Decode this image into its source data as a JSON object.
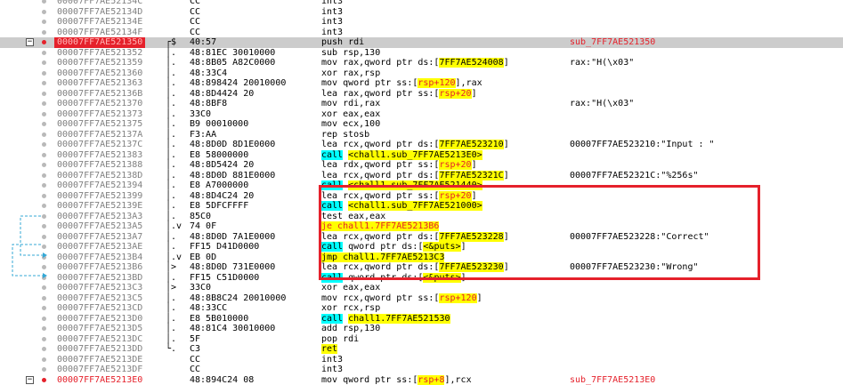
{
  "colors": {
    "breakpoint": "#e5212b",
    "selection": "#cccccc",
    "highlight_yellow": "#ffff00",
    "highlight_cyan": "#00ffff",
    "annotation_box": "#e5212b"
  },
  "icons": {
    "breakpoint": "breakpoint-dot-icon",
    "fold": "collapse-box-icon",
    "jump_arrow": "jump-arrow-icon"
  },
  "fold_symbol": "−",
  "rows": [
    {
      "addr": "00007FF7AE52134C",
      "bytes": "CC",
      "instr": [
        [
          "int3",
          ""
        ]
      ],
      "comment": ""
    },
    {
      "addr": "00007FF7AE52134D",
      "bytes": "CC",
      "instr": [
        [
          "int3",
          ""
        ]
      ],
      "comment": ""
    },
    {
      "addr": "00007FF7AE52134E",
      "bytes": "CC",
      "instr": [
        [
          "int3",
          ""
        ]
      ],
      "comment": ""
    },
    {
      "addr": "00007FF7AE52134F",
      "bytes": "CC",
      "instr": [
        [
          "int3",
          ""
        ]
      ],
      "comment": ""
    },
    {
      "addr": "00007FF7AE521350",
      "flag": "┌$",
      "bytes": "40:57",
      "instr": [
        [
          "push rdi",
          ""
        ]
      ],
      "comment": "sub_7FF7AE521350",
      "current": true,
      "bp": "on",
      "fold": true,
      "commentRed": true
    },
    {
      "addr": "00007FF7AE521352",
      "flag": "│.",
      "bytes": "48:81EC 30010000",
      "instr": [
        [
          "sub rsp,130",
          ""
        ]
      ],
      "comment": ""
    },
    {
      "addr": "00007FF7AE521359",
      "flag": "│.",
      "bytes": "48:8B05 A82C0000",
      "instr": [
        [
          "mov rax,qword ptr ds:[",
          ""
        ],
        [
          "7FF7AE524008",
          "y"
        ],
        [
          "]",
          ""
        ]
      ],
      "comment": "rax:\"H⁣⁣(⁣\\x03\""
    },
    {
      "addr": "00007FF7AE521360",
      "flag": "│.",
      "bytes": "48:33C4",
      "instr": [
        [
          "xor rax,rsp",
          ""
        ]
      ],
      "comment": ""
    },
    {
      "addr": "00007FF7AE521363",
      "flag": "│.",
      "bytes": "48:898424 20010000",
      "instr": [
        [
          "mov qword ptr ss:[",
          ""
        ],
        [
          "rsp+120",
          "yr"
        ],
        [
          "],rax",
          ""
        ]
      ],
      "comment": ""
    },
    {
      "addr": "00007FF7AE52136B",
      "flag": "│.",
      "bytes": "48:8D4424 20",
      "instr": [
        [
          "lea rax,qword ptr ss:[",
          ""
        ],
        [
          "rsp+20",
          "yr"
        ],
        [
          "]",
          ""
        ]
      ],
      "comment": ""
    },
    {
      "addr": "00007FF7AE521370",
      "flag": "│.",
      "bytes": "48:8BF8",
      "instr": [
        [
          "mov rdi,rax",
          ""
        ]
      ],
      "comment": "rax:\"H⁣⁣(⁣\\x03\""
    },
    {
      "addr": "00007FF7AE521373",
      "flag": "│.",
      "bytes": "33C0",
      "instr": [
        [
          "xor eax,eax",
          ""
        ]
      ],
      "comment": ""
    },
    {
      "addr": "00007FF7AE521375",
      "flag": "│.",
      "bytes": "B9 00010000",
      "instr": [
        [
          "mov ecx,100",
          ""
        ]
      ],
      "comment": ""
    },
    {
      "addr": "00007FF7AE52137A",
      "flag": "│.",
      "bytes": "F3:AA",
      "instr": [
        [
          "rep stosb",
          ""
        ]
      ],
      "comment": ""
    },
    {
      "addr": "00007FF7AE52137C",
      "flag": "│.",
      "bytes": "48:8D0D 8D1E0000",
      "instr": [
        [
          "lea rcx,qword ptr ds:[",
          ""
        ],
        [
          "7FF7AE523210",
          "y"
        ],
        [
          "]",
          ""
        ]
      ],
      "comment": "00007FF7AE523210:\"Input : \""
    },
    {
      "addr": "00007FF7AE521383",
      "flag": "│.",
      "bytes": "E8 58000000",
      "instr": [
        [
          "call",
          "c"
        ],
        [
          " ",
          ""
        ],
        [
          "<chall1.sub_7FF7AE5213E0>",
          "y"
        ]
      ],
      "comment": ""
    },
    {
      "addr": "00007FF7AE521388",
      "flag": "│.",
      "bytes": "48:8D5424 20",
      "instr": [
        [
          "lea rdx,qword ptr ss:[",
          ""
        ],
        [
          "rsp+20",
          "yr"
        ],
        [
          "]",
          ""
        ]
      ],
      "comment": ""
    },
    {
      "addr": "00007FF7AE52138D",
      "flag": "│.",
      "bytes": "48:8D0D 881E0000",
      "instr": [
        [
          "lea rcx,qword ptr ds:[",
          ""
        ],
        [
          "7FF7AE52321C",
          "y"
        ],
        [
          "]",
          ""
        ]
      ],
      "comment": "00007FF7AE52321C:\"%256s\""
    },
    {
      "addr": "00007FF7AE521394",
      "flag": "│.",
      "bytes": "E8 A7000000",
      "instr": [
        [
          "call",
          "c"
        ],
        [
          " ",
          ""
        ],
        [
          "<chall1.sub_7FF7AE521440>",
          "y"
        ]
      ],
      "comment": ""
    },
    {
      "addr": "00007FF7AE521399",
      "flag": "│.",
      "bytes": "48:8D4C24 20",
      "instr": [
        [
          "lea rcx,qword ptr ss:[",
          ""
        ],
        [
          "rsp+20",
          "yr"
        ],
        [
          "]",
          ""
        ]
      ],
      "comment": ""
    },
    {
      "addr": "00007FF7AE52139E",
      "flag": "│.",
      "bytes": "E8 5DFCFFFF",
      "instr": [
        [
          "call",
          "c"
        ],
        [
          " ",
          ""
        ],
        [
          "<chall1.sub_7FF7AE521000>",
          "y"
        ]
      ],
      "comment": ""
    },
    {
      "addr": "00007FF7AE5213A3",
      "flag": "│.",
      "bytes": "85C0",
      "instr": [
        [
          "test eax,eax",
          ""
        ]
      ],
      "comment": ""
    },
    {
      "addr": "00007FF7AE5213A5",
      "flag": "│.v",
      "bytes": "74 0F",
      "instr": [
        [
          "je chall1.7FF7AE5213B6",
          "yr"
        ]
      ],
      "comment": ""
    },
    {
      "addr": "00007FF7AE5213A7",
      "flag": "│.",
      "bytes": "48:8D0D 7A1E0000",
      "instr": [
        [
          "lea rcx,qword ptr ds:[",
          ""
        ],
        [
          "7FF7AE523228",
          "y"
        ],
        [
          "]",
          ""
        ]
      ],
      "comment": "00007FF7AE523228:\"Correct\""
    },
    {
      "addr": "00007FF7AE5213AE",
      "flag": "│.",
      "bytes": "FF15 D41D0000",
      "instr": [
        [
          "call",
          "c"
        ],
        [
          " qword ptr ds:[",
          ""
        ],
        [
          "<&puts>",
          "y"
        ],
        [
          "]",
          ""
        ]
      ],
      "comment": ""
    },
    {
      "addr": "00007FF7AE5213B4",
      "flag": "│.v",
      "bytes": "EB 0D",
      "instr": [
        [
          "jmp chall1.7FF7AE5213C3",
          "y"
        ]
      ],
      "comment": ""
    },
    {
      "addr": "00007FF7AE5213B6",
      "flag": "│>",
      "bytes": "48:8D0D 731E0000",
      "instr": [
        [
          "lea rcx,qword ptr ds:[",
          ""
        ],
        [
          "7FF7AE523230",
          "y"
        ],
        [
          "]",
          ""
        ]
      ],
      "comment": "00007FF7AE523230:\"Wrong\""
    },
    {
      "addr": "00007FF7AE5213BD",
      "flag": "│.",
      "bytes": "FF15 C51D0000",
      "instr": [
        [
          "call",
          "c"
        ],
        [
          " qword ptr ds:[",
          ""
        ],
        [
          "<&puts>",
          "y"
        ],
        [
          "]",
          ""
        ]
      ],
      "comment": ""
    },
    {
      "addr": "00007FF7AE5213C3",
      "flag": "│>",
      "bytes": "33C0",
      "instr": [
        [
          "xor eax,eax",
          ""
        ]
      ],
      "comment": ""
    },
    {
      "addr": "00007FF7AE5213C5",
      "flag": "│.",
      "bytes": "48:8B8C24 20010000",
      "instr": [
        [
          "mov rcx,qword ptr ss:[",
          ""
        ],
        [
          "rsp+120",
          "yr"
        ],
        [
          "]",
          ""
        ]
      ],
      "comment": ""
    },
    {
      "addr": "00007FF7AE5213CD",
      "flag": "│.",
      "bytes": "48:33CC",
      "instr": [
        [
          "xor rcx,rsp",
          ""
        ]
      ],
      "comment": ""
    },
    {
      "addr": "00007FF7AE5213D0",
      "flag": "│.",
      "bytes": "E8 5B010000",
      "instr": [
        [
          "call",
          "c"
        ],
        [
          " ",
          ""
        ],
        [
          "chall1.7FF7AE521530",
          "y"
        ]
      ],
      "comment": ""
    },
    {
      "addr": "00007FF7AE5213D5",
      "flag": "│.",
      "bytes": "48:81C4 30010000",
      "instr": [
        [
          "add rsp,130",
          ""
        ]
      ],
      "comment": ""
    },
    {
      "addr": "00007FF7AE5213DC",
      "flag": "│.",
      "bytes": "5F",
      "instr": [
        [
          "pop rdi",
          ""
        ]
      ],
      "comment": ""
    },
    {
      "addr": "00007FF7AE5213DD",
      "flag": "└.",
      "bytes": "C3",
      "instr": [
        [
          "ret",
          "y"
        ]
      ],
      "comment": ""
    },
    {
      "addr": "00007FF7AE5213DE",
      "bytes": "CC",
      "instr": [
        [
          "int3",
          ""
        ]
      ],
      "comment": ""
    },
    {
      "addr": "00007FF7AE5213DF",
      "bytes": "CC",
      "instr": [
        [
          "int3",
          ""
        ]
      ],
      "comment": ""
    },
    {
      "addr": "00007FF7AE5213E0",
      "flag": "",
      "bytes": "48:894C24 08",
      "instr": [
        [
          "mov qword ptr ss:[",
          ""
        ],
        [
          "rsp+8",
          "yr"
        ],
        [
          "],rcx",
          ""
        ]
      ],
      "comment": "sub_7FF7AE5213E0",
      "bp": "on",
      "fold": true,
      "addrRed": true,
      "commentRed": true
    }
  ]
}
